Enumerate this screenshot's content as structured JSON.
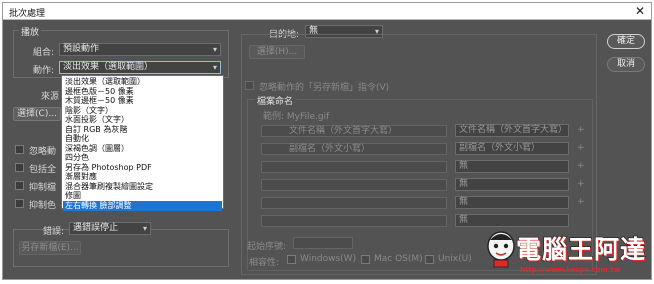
{
  "window": {
    "title": "批次處理",
    "close_glyph": "✕"
  },
  "buttons": {
    "ok": "確定",
    "cancel": "取消"
  },
  "play": {
    "legend": "播放",
    "set_label": "組合:",
    "set_value": "預設動作",
    "action_label": "動作:",
    "action_value": "淡出效果（選取範圍）"
  },
  "source": {
    "label": "來源",
    "choose_button": "選擇(C)..."
  },
  "left_checks": [
    "忽略動",
    "包括全",
    "抑制檔",
    "抑制色"
  ],
  "errors": {
    "label": "錯誤:",
    "value": "遇錯誤停止",
    "save_as_button": "另存新檔(E)..."
  },
  "dropdown": {
    "items": [
      "淡出效果（選取範圍）",
      "邊框色版－50 像素",
      "木質邊框－50 像素",
      "陰影（文字）",
      "水面投影（文字）",
      "自訂 RGB 為灰階",
      "自動化",
      "深褐色調（圖層）",
      "四分色",
      "另存為 Photoshop PDF",
      "漸層對應",
      "混合器筆刷複製繪圖設定",
      "修圖",
      "左右轉換  臉部調整"
    ],
    "highlighted_index": 13
  },
  "destination": {
    "label": "目的地:",
    "value": "無",
    "choose_button": "選擇(H)...",
    "override_check": "忽略動作的「另存新檔」指令(V)"
  },
  "naming": {
    "legend": "檔案命名",
    "example": "範例: MyFile.gif",
    "rows": [
      {
        "left": "文件名稱（外文首字大寫）",
        "right": "文件名稱（外文首字大寫）"
      },
      {
        "left": "副檔名（外文小寫）",
        "right": "副檔名（外文小寫）"
      },
      {
        "left": "",
        "right": "無"
      },
      {
        "left": "",
        "right": "無"
      },
      {
        "left": "",
        "right": "無"
      },
      {
        "left": "",
        "right": "無"
      }
    ],
    "start_serial_label": "起始序號:",
    "compat_label": "相容性:",
    "compat_options": [
      "Windows(W)",
      "Mac OS(M)",
      "Unix(U)"
    ]
  },
  "watermark": {
    "brand": "電腦王阿達",
    "url": "http://www.kocpc.com.tw"
  },
  "colors": {
    "dialog_bg": "#535353",
    "highlight": "#1e74d0",
    "watermark_red": "#e02a2a"
  }
}
